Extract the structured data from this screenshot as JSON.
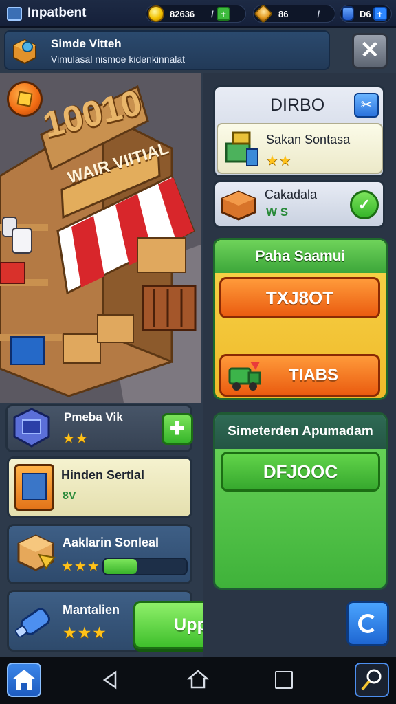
{
  "header": {
    "title": "Inpatbent",
    "coins": "82636",
    "coins_separator": "/",
    "gems": "86",
    "gems_separator": "/",
    "potions": "D6"
  },
  "notification": {
    "title": "Simde Vitteh",
    "message": "Vimulasal nismoe kidenkinnalat"
  },
  "scene": {
    "sign_number": "10010",
    "banner": "WAIR VIITIAL"
  },
  "left_items": [
    {
      "name": "Pmeba Vik",
      "stars": "★★"
    },
    {
      "name": "Hinden Sertlal",
      "meta": "8V"
    },
    {
      "name": "Aaklarin Sonleal",
      "stars": "★★★",
      "progress": 0.4
    },
    {
      "name": "Mantalien",
      "stars": "★★★"
    }
  ],
  "upgrade_label": "Uppade",
  "right_panel": {
    "header": "DIRBO",
    "item1": {
      "name": "Sakan Sontasa",
      "stars": "★★"
    },
    "item2": {
      "name": "Cakadala",
      "meta": "W S"
    },
    "section1": {
      "title": "Paha Saamui",
      "button1": "TXJ8OT",
      "button2": "TIABS"
    },
    "section2": {
      "title": "Simeterden Apumadam",
      "button": "DFJOOC"
    }
  },
  "colors": {
    "accent_green": "#3dbb3d",
    "accent_orange": "#f06a12",
    "accent_yellow": "#f4c532",
    "panel_dark": "#2a3545",
    "header_blue": "#1d2a44"
  }
}
